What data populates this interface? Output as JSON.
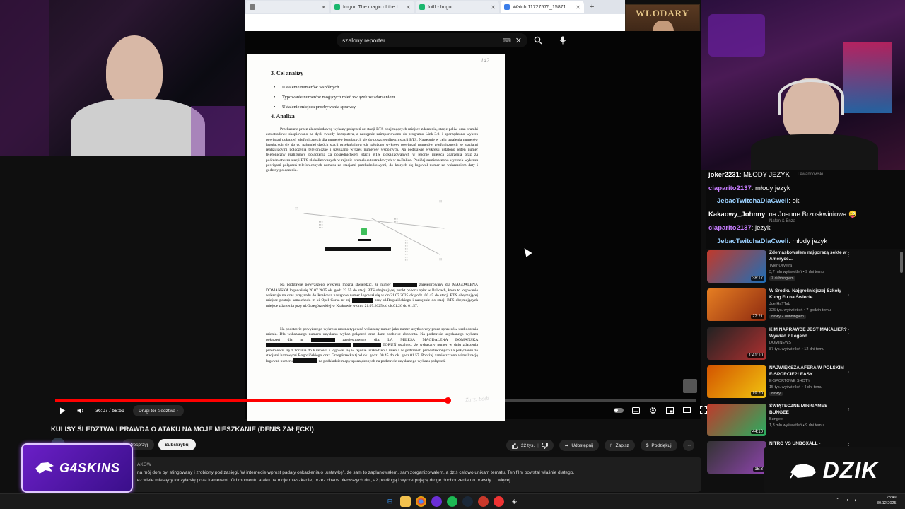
{
  "browser": {
    "tabs": [
      {
        "label": "",
        "color": "#7a7a7a"
      },
      {
        "label": "Imgur: The magic of the Intern",
        "color": "#1bb76e"
      },
      {
        "label": "fotff - Imgur",
        "color": "#1bb76e"
      },
      {
        "label": "Watch 11727576_1587193221...",
        "color": "#3b7de9"
      }
    ],
    "new_tab": "+"
  },
  "youtube": {
    "search_query": "szalony reporter",
    "keyboard_icon": "⌨",
    "clear": "✕"
  },
  "document": {
    "page_number": "142",
    "heading_3": "3. Cel analizy",
    "bullets": [
      "Ustalenie numerów wspólnych",
      "Typowanie numerów mogących mieć związek ze zdarzeniem",
      "Ustalenie miejsca przebywania sprawcy"
    ],
    "heading_4": "4. Analiza",
    "para1": "Przekazane przez zleceniodawcę wykazy połączeń ze stacji BTS obejmujących miejsce zdarzenia, stacje paliw oraz bramki autostradowe skopiowano na dysk twardy komputera, a następnie zaimportowano do programu Link-3.0. i sporządzono wykres powiązań połączeń telefonicznych dla numerów logujących się do poszczególnych stacji BTS. Następnie w celu ustalenia numerów logujących się do co najmniej dwóch stacji przekaźnikowych nałożono wykresy powiązań numerów telefonicznych ze stacjami realizującymi połączenia telefoniczne i uzyskano wykres numerów wspólnych. Na podstawie wykresu ustalono jeden numer telefoniczny realizujący połączenia za pośrednictwem stacji BTS zlokalizowanych w rejonie miejsca zdarzenia oraz za pośrednictwem stacji BTS zlokalizowanych w rejonie bramek autostradowych w m.Balice. Poniżej zamieszczono wycinek wykresu powiązań połączeń telefonicznych numeru ze stacjami przekaźnikowymi, do których się logował numer ze wskazaniem daty i godziny połączenia.",
    "para2a": "Na podstawie powyższego wykresu można stwierdzić, że numer",
    "para2b": "zarejestrowany dla MAGDALENA DOMAŃSKA logował się 20.07.2025 ok. godz.22.55 do stacji BTS obejmującej punkt poboru opłat w Balicach, które to logowanie wskazuje na czas przyjazdu do Krakowa następnie numer logował się w dn.21.07.2025 ok.godz. 00.45 do stacji BTS obejmującej miejsce postoju samochodu m-ki Opel Corsa nr rej",
    "para2c": "przy ul.Rogozińskiego i następnie do stacji BTS obejmujących miejsce zdarzenia przy ul.Grzegórzeckiej w Krakowie w dniu 21.07.2025 od ok.01.26 do 01.57.",
    "para3a": "Na podstawie powyższego wykresu można typować wskazany numer jako numer użytkowany przez sprawców uszkodzenia mienia. Dla wskazanego numeru uzyskano wykaz połączeń oraz dane osobowe abonenta. Na podstawie uzyskanego wykazu połączeń dla nr",
    "para3b": "zarejestrowany dla: LA MILESA MAGDALENA DOMAŃSKA",
    "para3c": "TORUŃ ustalono, że wskazany numer w dniu zdarzenia przemieścił się z Torunia do Krakowa i logował się w rejonie uszkodzenia mienia w godzinach przedstawionych na połączeniu ze stacjami bazowymi Rogozińskiego oraz Grzegórzecka tj.od ok. godz. 00.45 do ok. godz.01.57. Poniżej zamieszczono wizualizację logowań numeru",
    "para3d": "na podkładzie mapy sporządzonych na podstawie uzyskanego wykazu połączeń.",
    "stamp": "Zarz. Łódź"
  },
  "player": {
    "time": "36:07 / 58:51",
    "chapter": "Drugi tor śledztwa",
    "progress_fraction": 0.6136
  },
  "video": {
    "title": "KULISY ŚLEDZTWA I PRAWDA O ATAKU NA MOJE MIESZKANIE (DENIS ZAŁĘCKI)",
    "channel": "Szalony Podcast",
    "subs": "",
    "support_label": "Wesprzyj",
    "subscribe_label": "Subskrybuj",
    "likes": "22 tys.",
    "share": "Udostępnij",
    "save": "Zapisz",
    "thanks": "Podziękuj",
    "desc_prefix": "AKÓW",
    "desc_line1": "na mój dom był sfingowany i zrobiony pod zasięgi. W internecie wprost padały oskarżenia o „ustawkę\", że sam to zaplanowałem, sam zorganizowałem, a dziś celowo unikam tematu. Ten film powstał właśnie dlatego.",
    "desc_line2": "ez wiele miesięcy toczyła się poza kamerami. Od momentu ataku na moje mieszkanie, przez chaos pierwszych dni, aż po długą i wyczerpującą drogę dochodzenia do prawdy ... więcej"
  },
  "chat": {
    "messages": [
      {
        "user": "joker2231",
        "text": "MŁODY JEZYK",
        "color": "#ffffff"
      },
      {
        "user": "ciaparito2137",
        "text": "młody jezyk",
        "color": "#c77dff"
      },
      {
        "user": "JebacTwitchaDlaCweli",
        "text": "oki",
        "color": "#9bd1ff"
      },
      {
        "user": "Kakaowy_Johnny",
        "text": "na Joanne Brzoskwiniowa 😜",
        "color": "#ffffff"
      },
      {
        "user": "ciaparito2137",
        "text": "jezyk",
        "color": "#c77dff"
      },
      {
        "user": "JebacTwitchaDlaCweli",
        "text": "młody jezyk",
        "color": "#9bd1ff"
      }
    ],
    "ghost1": "Lewandowski",
    "ghost2": "Nafan & Enza"
  },
  "recommendations": [
    {
      "title": "Zdemaskowałem najgorszą sektę w Ameryce...",
      "channel": "Tyler Oliveira",
      "meta": "3,7 mln wyświetleń • 9 dni temu",
      "badge": "Z dubbingiem",
      "duration": "38:17",
      "c1": "#c0392b",
      "c2": "#1e6fb8"
    },
    {
      "title": "W Środku Najgroźniejszej Szkoły Kung Fu na Świecie ...",
      "channel": "Joe HaTTab",
      "meta": "325 tys. wyświetleń • 7 godzin temu",
      "badge": "Nowy  Z dubbingiem",
      "duration": "27:21",
      "c1": "#e67e22",
      "c2": "#8e2a10"
    },
    {
      "title": "KIM NAPRAWDĘ JEST MAKALIER? Wywiad z Legend...",
      "channel": "DOMINEWS",
      "meta": "87 tys. wyświetleń • 12 dni temu",
      "badge": "",
      "duration": "1:41:10",
      "c1": "#222222",
      "c2": "#b03030"
    },
    {
      "title": "NAJWIĘKSZA AFERA W POLSKIM E-SPORCIE?! EASY ...",
      "channel": "E-SPORTOWE SHOTY",
      "meta": "15 tys. wyświetleń • 4 dni temu",
      "badge": "Nowy",
      "duration": "19:20",
      "c1": "#d35400",
      "c2": "#f1c40f"
    },
    {
      "title": "ŚWIĄTECZNE MINIGAMES BUNGEE",
      "channel": "Bungee",
      "meta": "1,3 mln wyświetleń • 9 dni temu",
      "badge": "",
      "duration": "44:10",
      "c1": "#c0392b",
      "c2": "#27ae60"
    },
    {
      "title": "NITRO VS UNBOXALL -",
      "channel": "",
      "meta": "",
      "badge": "",
      "duration": "15:3",
      "c1": "#333333",
      "c2": "#8e44ad"
    }
  ],
  "overlays": {
    "poster": "WLODARY",
    "g4skins": "G4SKINS",
    "dzik": "DZIK"
  },
  "taskbar": {
    "time": "23:49",
    "date": "30.12.2025"
  }
}
